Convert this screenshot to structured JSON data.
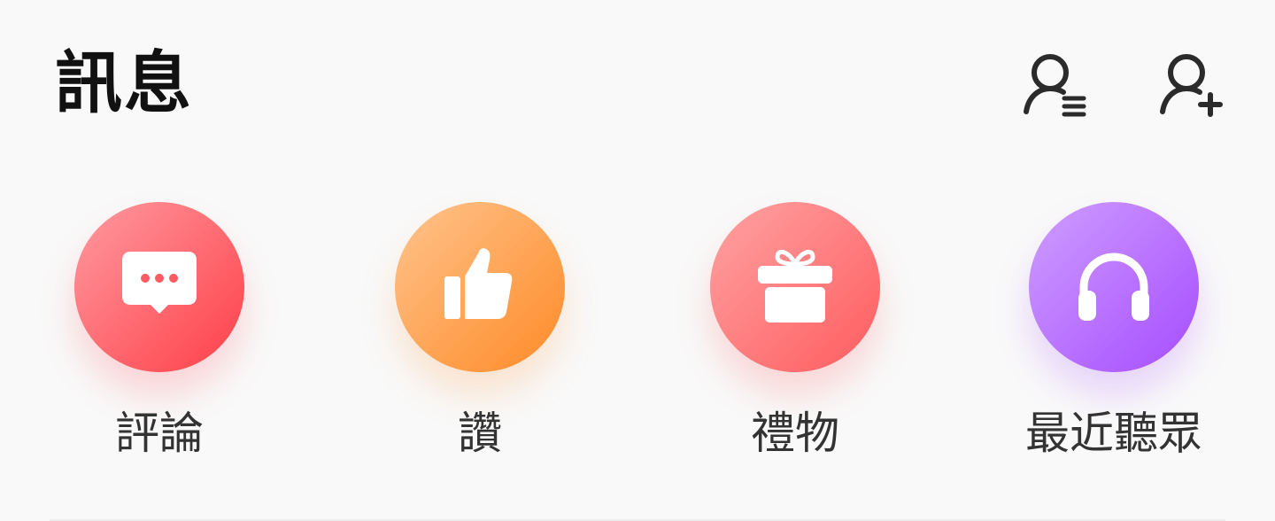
{
  "header": {
    "title": "訊息",
    "contacts_icon": "user-list-icon",
    "add_friend_icon": "user-plus-icon"
  },
  "shortcuts": [
    {
      "label": "評論",
      "icon": "chat-bubble-icon",
      "color": "#ff4d55"
    },
    {
      "label": "讚",
      "icon": "thumbs-up-icon",
      "color": "#ff9a3c"
    },
    {
      "label": "禮物",
      "icon": "gift-icon",
      "color": "#ff6b6e"
    },
    {
      "label": "最近聽眾",
      "icon": "headphones-icon",
      "color": "#b25cff"
    }
  ]
}
